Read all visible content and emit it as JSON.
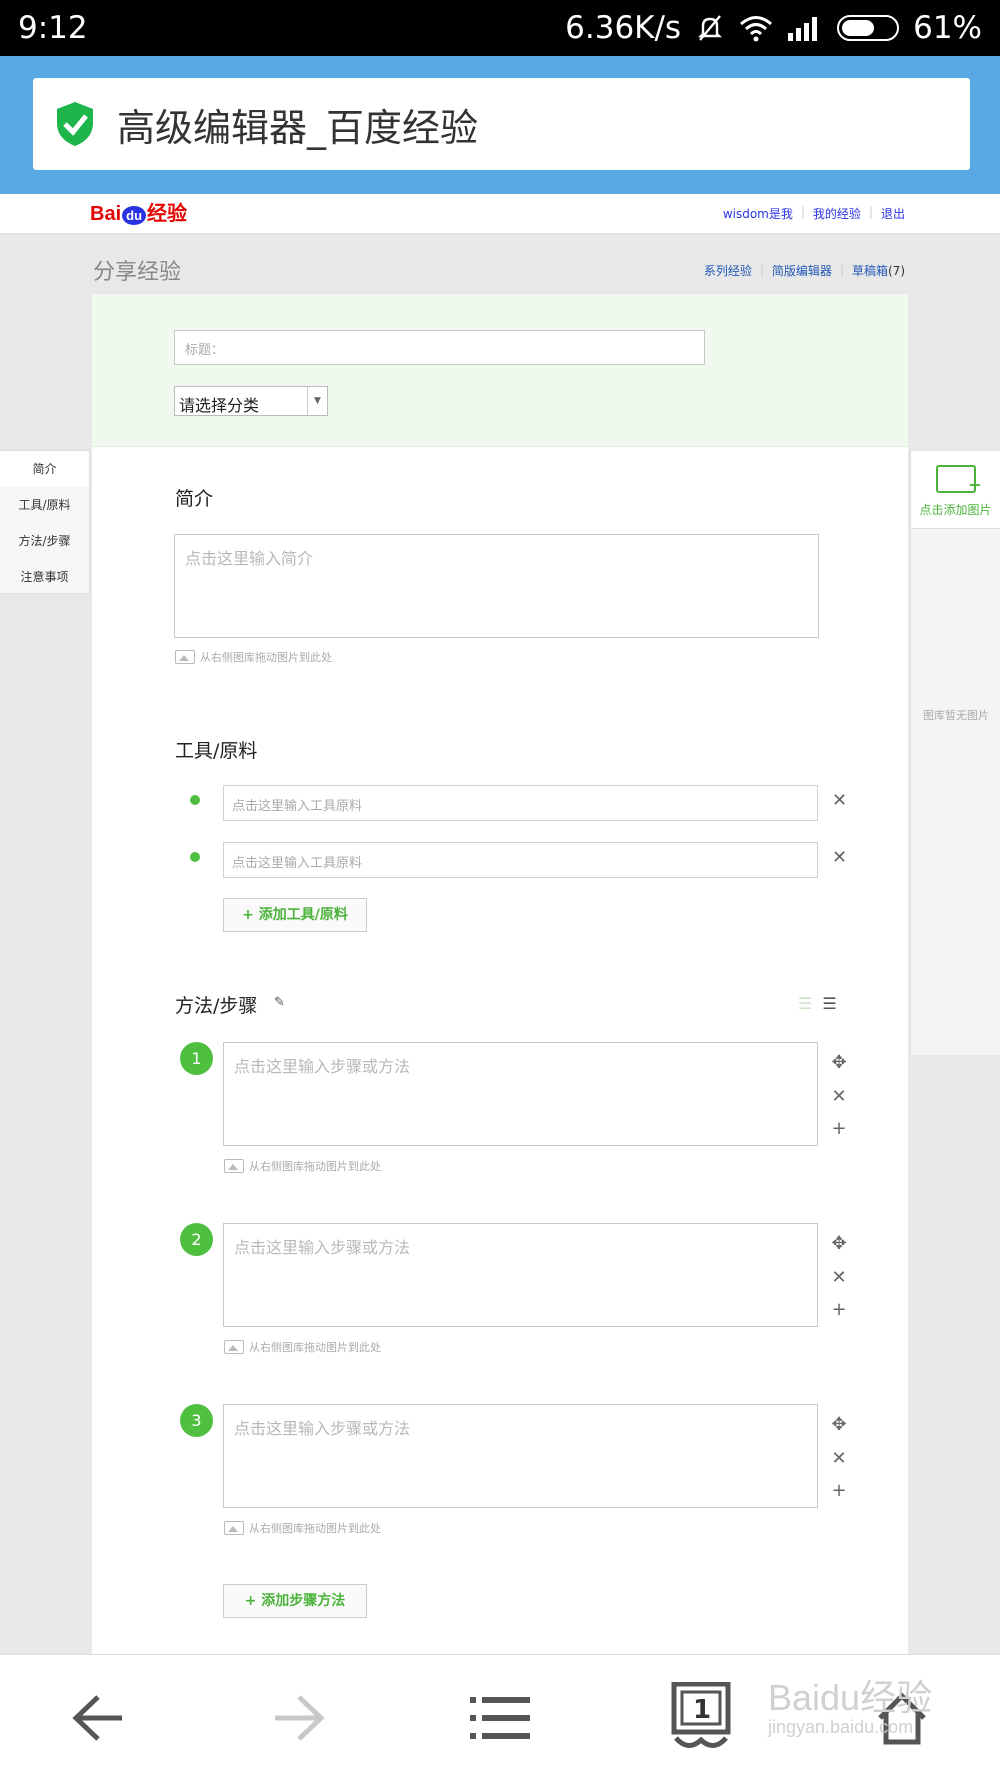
{
  "status_bar": {
    "time": "9:12",
    "net_speed": "6.36K/s",
    "battery": "61%",
    "battery_level": 0.61
  },
  "url_bar": {
    "page_title": "高级编辑器_百度经验"
  },
  "header": {
    "logo_bai": "Bai",
    "logo_du": "du",
    "logo_jy": "经验",
    "links": [
      "wisdom是我",
      "我的经验",
      "退出"
    ]
  },
  "subheader": {
    "title": "分享经验",
    "links": [
      "系列经验",
      "简版编辑器",
      "草稿箱"
    ],
    "draft_count": "(7)"
  },
  "form": {
    "title_placeholder": "标题：",
    "category_selected": "请选择分类"
  },
  "intro": {
    "title": "简介",
    "placeholder": "点击这里输入简介",
    "drag_hint": "从右侧图库拖动图片到此处"
  },
  "tools": {
    "title": "工具/原料",
    "items": [
      {
        "placeholder": "点击这里输入工具原料"
      },
      {
        "placeholder": "点击这里输入工具原料"
      }
    ],
    "add_label": "+ 添加工具/原料"
  },
  "steps": {
    "title": "方法/步骤",
    "items": [
      {
        "number": "1",
        "placeholder": "点击这里输入步骤或方法",
        "drag_hint": "从右侧图库拖动图片到此处"
      },
      {
        "number": "2",
        "placeholder": "点击这里输入步骤或方法",
        "drag_hint": "从右侧图库拖动图片到此处"
      },
      {
        "number": "3",
        "placeholder": "点击这里输入步骤或方法",
        "drag_hint": "从右侧图库拖动图片到此处"
      }
    ],
    "add_label": "+ 添加步骤方法"
  },
  "left_nav": {
    "items": [
      "简介",
      "工具/原料",
      "方法/步骤",
      "注意事项"
    ]
  },
  "gallery": {
    "add_label": "点击添加图片",
    "empty_label": "图库暂无图片"
  },
  "bottom_nav": {
    "tab_count": "1",
    "watermark_main": "Baidu经验",
    "watermark_sub": "jingyan.baidu.com"
  },
  "colors": {
    "accent_green": "#4fbf40",
    "url_bar_blue": "#58a9e3",
    "link_blue": "#2932e1"
  }
}
